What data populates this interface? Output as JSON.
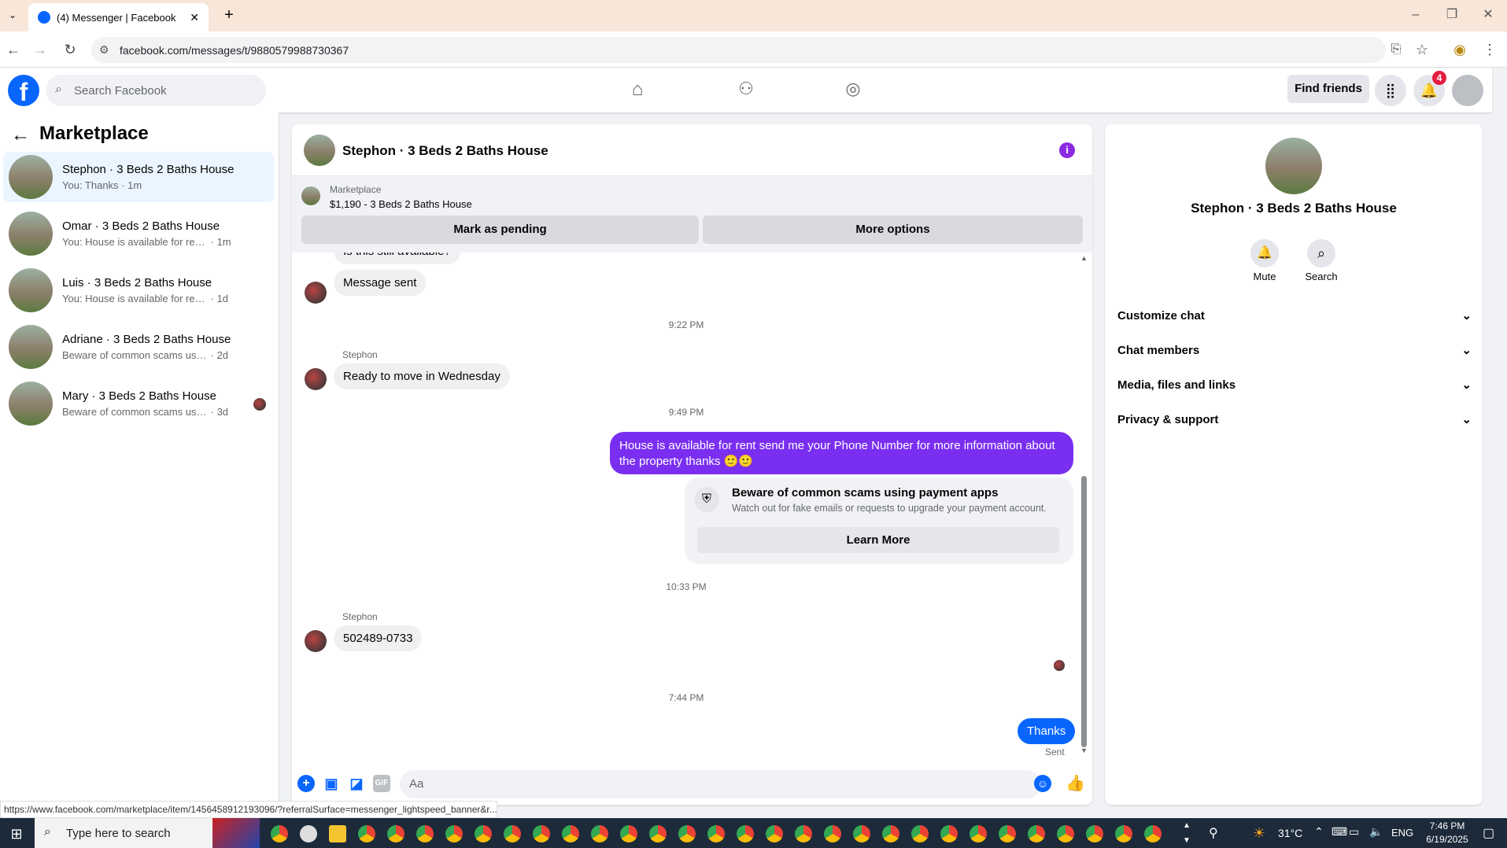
{
  "browser": {
    "tab_title": "(4) Messenger | Facebook",
    "new_tab": "+",
    "url": "facebook.com/messages/t/9880579988730367",
    "status_url": "https://www.facebook.com/marketplace/item/1456458912193096/?referralSurface=messenger_lightspeed_banner&r..."
  },
  "header": {
    "search_placeholder": "Search Facebook",
    "find_friends": "Find friends",
    "notification_count": "4"
  },
  "sidebar": {
    "title": "Marketplace",
    "conversations": [
      {
        "name": "Stephon · 3 Beds 2 Baths House",
        "snippet": "You: Thanks",
        "time": "· 1m",
        "active": true
      },
      {
        "name": "Omar · 3 Beds 2 Baths House",
        "snippet": "You: House is available for rent send ...",
        "time": "· 1m"
      },
      {
        "name": "Luis · 3 Beds 2 Baths House",
        "snippet": "You: House is available for rent send ...",
        "time": "· 1d"
      },
      {
        "name": "Adriane · 3 Beds 2 Baths House",
        "snippet": "Beware of common scams using pay...",
        "time": "· 2d"
      },
      {
        "name": "Mary · 3 Beds 2 Baths House",
        "snippet": "Beware of common scams using p...",
        "time": "· 3d"
      }
    ]
  },
  "chat": {
    "title": "Stephon · 3 Beds 2 Baths House",
    "marketplace_label": "Marketplace",
    "listing": "$1,190 - 3 Beds 2 Baths House",
    "mark_pending": "Mark as pending",
    "more_options": "More options",
    "cut_message": "Is this still available?",
    "msg_sent": "Message sent",
    "ts1": "9:22 PM",
    "sender1": "Stephon",
    "msg_ready": "Ready to move in Wednesday",
    "ts2": "9:49 PM",
    "out_message": "House is available for rent send me your Phone Number for more information about the property thanks 🙂🙂",
    "scam_title": "Beware of common scams using payment apps",
    "scam_desc": "Watch out for fake emails or requests to upgrade your payment account.",
    "learn_more": "Learn More",
    "ts3": "10:33 PM",
    "sender2": "Stephon",
    "msg_phone": "502489-0733",
    "ts4": "7:44 PM",
    "msg_thanks": "Thanks",
    "sent_label": "Sent",
    "composer_placeholder": "Aa"
  },
  "right_panel": {
    "name": "Stephon · 3 Beds 2 Baths House",
    "mute": "Mute",
    "search": "Search",
    "sections": [
      "Customize chat",
      "Chat members",
      "Media, files and links",
      "Privacy & support"
    ]
  },
  "taskbar": {
    "search_placeholder": "Type here to search",
    "temperature": "31°C",
    "lang": "ENG",
    "time": "7:46 PM",
    "date": "6/19/2025"
  }
}
